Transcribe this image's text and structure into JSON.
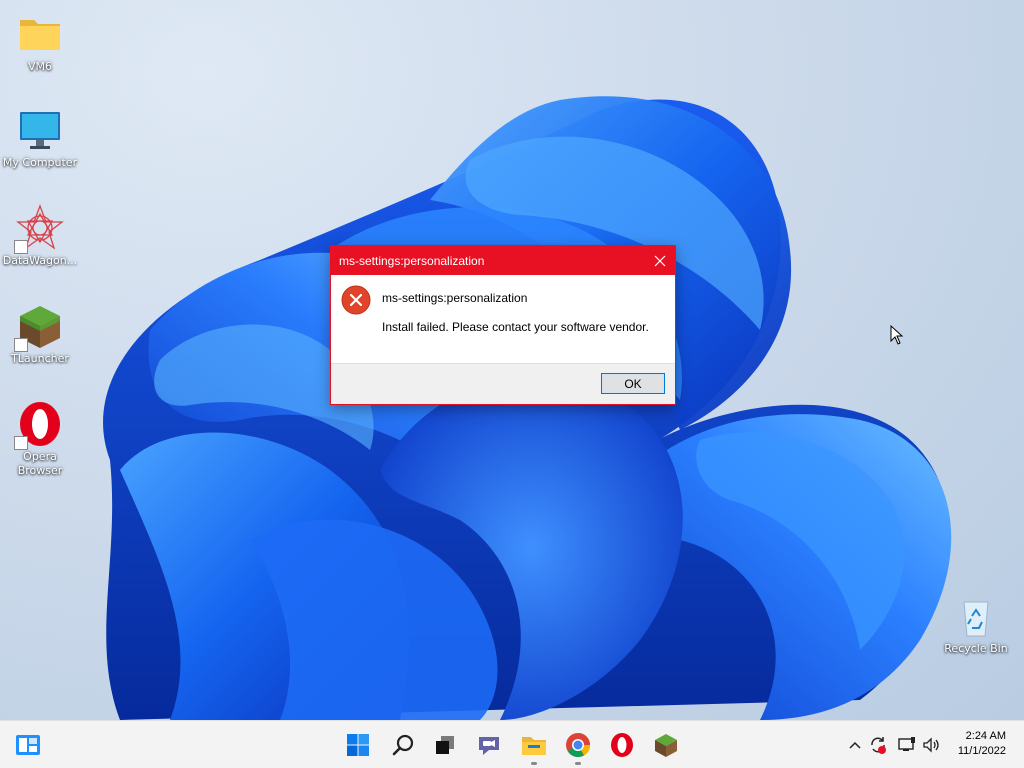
{
  "desktop": {
    "icons": [
      {
        "label": "VM6",
        "icon": "folder-icon"
      },
      {
        "label": "My Computer",
        "icon": "monitor-icon"
      },
      {
        "label": "DataWagon...",
        "icon": "datawagon-icon"
      },
      {
        "label": "TLauncher",
        "icon": "minecraft-block-icon"
      },
      {
        "label": "Opera Browser",
        "icon": "opera-icon"
      },
      {
        "label": "Recycle Bin",
        "icon": "recycle-bin-icon"
      }
    ]
  },
  "dialog": {
    "title": "ms-settings:personalization",
    "heading": "ms-settings:personalization",
    "message": "Install failed. Please contact your software vendor.",
    "ok_label": "OK",
    "accent_color": "#e81123"
  },
  "taskbar": {
    "pinned": [
      "start-icon",
      "search-icon",
      "task-view-icon",
      "teams-chat-icon",
      "file-explorer-icon",
      "chrome-icon",
      "opera-icon",
      "tlauncher-icon"
    ],
    "clock": {
      "time": "2:24 AM",
      "date": "11/1/2022"
    }
  },
  "colors": {
    "accent": "#0078d7",
    "error_red": "#e81123",
    "taskbar_bg": "#f3f3f3"
  }
}
